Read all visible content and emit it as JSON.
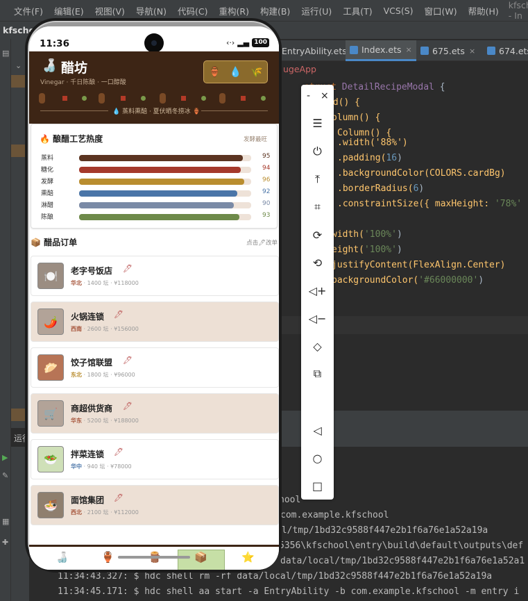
{
  "ide": {
    "menu": [
      "文件(F)",
      "编辑(E)",
      "视图(V)",
      "导航(N)",
      "代码(C)",
      "重构(R)",
      "构建(B)",
      "运行(U)",
      "工具(T)",
      "VCS(S)",
      "窗口(W)",
      "帮助(H)"
    ],
    "window_title": "kfschool - In",
    "project_name": "kfschoo",
    "tabs": [
      {
        "label": "EntryAbility.ets"
      },
      {
        "label": "Index.ets"
      },
      {
        "label": "675.ets"
      },
      {
        "label": "674.ets"
      }
    ],
    "breadcrumb": "ugeApp",
    "side_label": "运行",
    "code": {
      "l1_kw": "struct",
      "l1_name": "DetailRecipeModal",
      "l1_brace": "{",
      "l2": "ld() {",
      "l3": "olumn() {",
      "l4": "Column() {",
      "l5": ".width('88%')",
      "l6a": ".padding(",
      "l6n": "16",
      "l6b": ")",
      "l7a": ".backgroundColor(COLORS.cardBg)",
      "l8a": ".borderRadius(",
      "l8n": "6",
      "l8b": ")",
      "l9a": ".constraintSize({ maxHeight: ",
      "l9s": "'78%'",
      "l10a": "width(",
      "l10s": "'100%'",
      "l10b": ")",
      "l11a": "eight(",
      "l11s": "'100%'",
      "l11b": ")",
      "l12": "justifyContent(FlexAlign.Center)",
      "l13a": "backgroundColor(",
      "l13s": "'#66000000'",
      "l13b": ")"
    },
    "console": [
      "hool",
      "com.example.kfschool",
      "al/tmp/1bd32c9588f447e2b1f6a76e1a52a19a",
      "5356\\kfschool\\entry\\build\\default\\outputs\\def",
      "data/local/tmp/1bd32c9588f447e2b1f6a76e1a52a1",
      "11:34:43.327: $ hdc shell rm -rf data/local/tmp/1bd32c9588f447e2b1f6a76e1a52a19a",
      "11:34:45.171: $ hdc shell aa start -a EntryAbility -b com.example.kfschool -m entry i"
    ]
  },
  "emulator_toolbar": {
    "minimize": "-",
    "close": "×",
    "icons": [
      "menu-icon",
      "power-icon",
      "pin-top-icon",
      "crop-icon",
      "rotate-icon",
      "rotate-lock-icon",
      "volume-up-icon",
      "volume-down-icon",
      "shake-icon",
      "screenshot-icon",
      "back-icon",
      "home-icon",
      "recents-icon"
    ]
  },
  "app": {
    "status": {
      "time": "11:36",
      "battery": "100"
    },
    "header": {
      "title": "醋坊",
      "subtitle": "Vinegar · 千日陈酿 · 一口醇酸",
      "tagline": "蒸料熏醅 · 夏伏晒冬捞冰"
    },
    "heat_card": {
      "title": "酿醋工艺热度",
      "tag": "发酵最旺",
      "rows": [
        {
          "label": "蒸料",
          "value": "95",
          "color": "#5b3421"
        },
        {
          "label": "糖化",
          "value": "94",
          "color": "#a5392b"
        },
        {
          "label": "发酵",
          "value": "96",
          "color": "#b98d2f"
        },
        {
          "label": "熏醅",
          "value": "92",
          "color": "#4a75a8"
        },
        {
          "label": "淋醋",
          "value": "90",
          "color": "#7a8aa6"
        },
        {
          "label": "陈酿",
          "value": "93",
          "color": "#6e8a4a"
        }
      ]
    },
    "orders": {
      "title": "醋品订单",
      "hint": "点击🖊改单",
      "items": [
        {
          "name": "老字号饭店",
          "region": "华北",
          "qty": "1400 坛",
          "price": "¥118000",
          "icon": "🍽️",
          "bg": "#ffffff",
          "thumb": "#9b8d82",
          "region_color": "#a6553b"
        },
        {
          "name": "火锅连锁",
          "region": "西南",
          "qty": "2600 坛",
          "price": "¥156000",
          "icon": "🌶️",
          "bg": "#ede0d5",
          "thumb": "#b2a398",
          "region_color": "#a6553b"
        },
        {
          "name": "饺子馆联盟",
          "region": "东北",
          "qty": "1800 坛",
          "price": "¥96000",
          "icon": "🥟",
          "bg": "#ffffff",
          "thumb": "#b77456",
          "region_color": "#b98d2f"
        },
        {
          "name": "商超供货商",
          "region": "华东",
          "qty": "5200 坛",
          "price": "¥188000",
          "icon": "🛒",
          "bg": "#ede0d5",
          "thumb": "#b2a398",
          "region_color": "#a6553b"
        },
        {
          "name": "拌菜连锁",
          "region": "华中",
          "qty": "940 坛",
          "price": "¥78000",
          "icon": "🥗",
          "bg": "#ffffff",
          "thumb": "#cfe0b8",
          "region_color": "#4a75a8"
        },
        {
          "name": "面馆集团",
          "region": "西北",
          "qty": "2100 坛",
          "price": "¥112000",
          "icon": "🍜",
          "bg": "#ede0d5",
          "thumb": "#8f7f6e",
          "region_color": "#a6553b"
        }
      ]
    },
    "bottom_nav": [
      "bottle-icon",
      "jar-icon",
      "crate-icon",
      "box-icon",
      "star-icon"
    ]
  }
}
